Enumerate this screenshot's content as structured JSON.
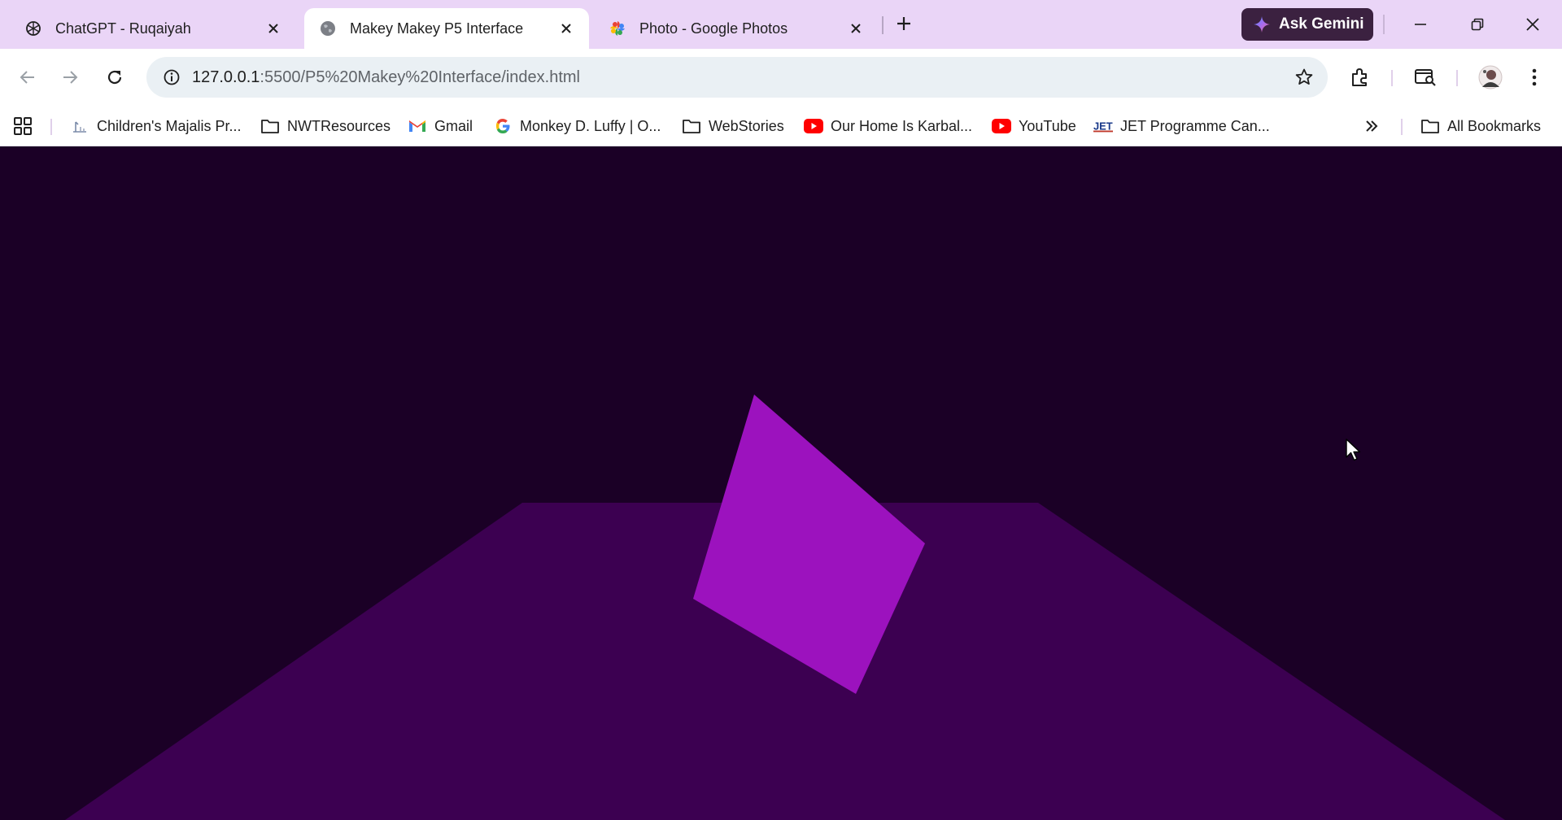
{
  "tabs": [
    {
      "title": "ChatGPT - Ruqaiyah",
      "icon": "chatgpt-icon",
      "active": false
    },
    {
      "title": "Makey Makey P5 Interface",
      "icon": "globe-icon",
      "active": true
    },
    {
      "title": "Photo - Google Photos",
      "icon": "google-photos-icon",
      "active": false
    }
  ],
  "gemini": {
    "label": "Ask Gemini"
  },
  "omnibox": {
    "host": "127.0.0.1",
    "path": ":5500/P5%20Makey%20Interface/index.html"
  },
  "bookmarks": [
    {
      "label": "Children's Majalis Pr...",
      "icon": "site-favicon"
    },
    {
      "label": "NWTResources",
      "icon": "folder-icon"
    },
    {
      "label": "Gmail",
      "icon": "gmail-icon"
    },
    {
      "label": "Monkey D. Luffy | O...",
      "icon": "google-icon"
    },
    {
      "label": "WebStories",
      "icon": "folder-icon"
    },
    {
      "label": "Our Home Is Karbal...",
      "icon": "youtube-icon"
    },
    {
      "label": "YouTube",
      "icon": "youtube-icon"
    },
    {
      "label": "JET Programme Can...",
      "icon": "jet-icon"
    }
  ],
  "all_bookmarks": {
    "label": "All Bookmarks"
  },
  "scene": {
    "background_color": "#1b0026",
    "floor_color": "#3c0051",
    "shape_color": "#9c12be"
  }
}
